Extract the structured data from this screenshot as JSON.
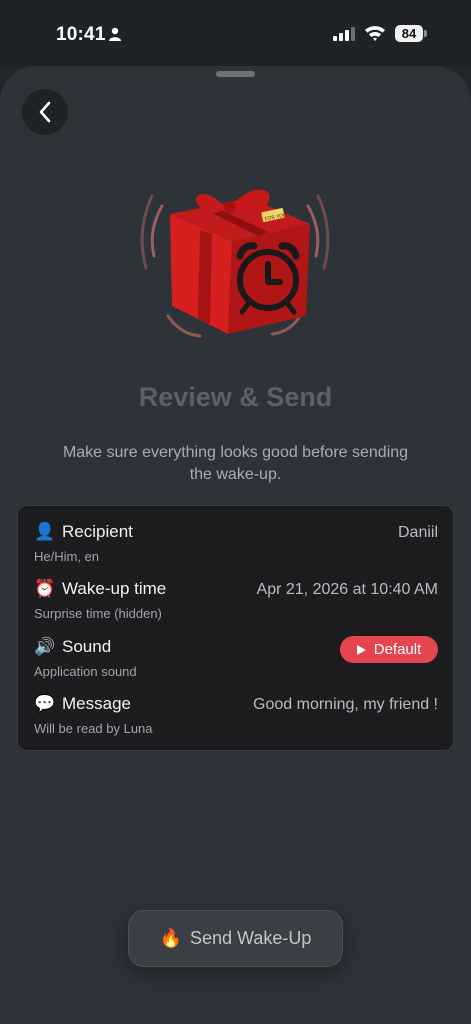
{
  "status_bar": {
    "time": "10:41",
    "battery": "84",
    "icons": [
      "person-icon",
      "signal-icon",
      "wifi-icon",
      "battery-icon"
    ]
  },
  "header": {
    "back_icon": "chevron-left-icon"
  },
  "hero": {
    "image": "gift-box-with-alarm-clock",
    "tag_text": "FOR YOU"
  },
  "title": "Review & Send",
  "subtitle": "Make sure everything looks good before sending the wake-up.",
  "summary": {
    "recipient": {
      "icon": "👤",
      "label": "Recipient",
      "sub": "He/Him, en",
      "value": "Daniil"
    },
    "wakeup_time": {
      "icon": "⏰",
      "label": "Wake-up time",
      "sub": "Surprise time (hidden)",
      "value": "Apr 21, 2026 at 10:40 AM"
    },
    "sound": {
      "icon": "🔊",
      "label": "Sound",
      "sub": "Application sound",
      "button_label": "Default"
    },
    "message": {
      "icon": "💬",
      "label": "Message",
      "sub": "Will be read by Luna",
      "value": "Good morning, my friend !"
    }
  },
  "send_button": {
    "icon": "🔥",
    "label": "Send Wake-Up"
  },
  "colors": {
    "background": "#2e3239",
    "card": "#1d1d20",
    "accent_red": "#e4454f",
    "title_gray": "#5c6068"
  }
}
